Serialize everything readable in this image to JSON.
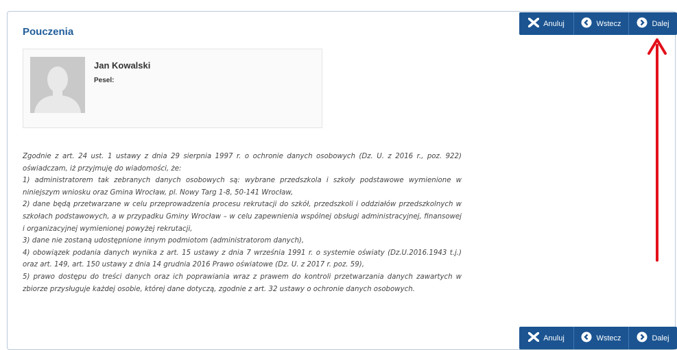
{
  "panel": {
    "title": "Pouczenia"
  },
  "person": {
    "name": "Jan Kowalski",
    "pesel_label": "Pesel:"
  },
  "notice": {
    "paragraphs": [
      "Zgodnie z art. 24 ust. 1 ustawy z dnia 29 sierpnia 1997 r. o ochronie danych osobowych (Dz. U. z 2016 r., poz. 922) oświadczam, iż przyjmuję do wiadomości, że:",
      "1) administratorem tak zebranych danych osobowych są: wybrane przedszkola i szkoły podstawowe wymienione w niniejszym wniosku oraz Gmina Wrocław, pl. Nowy Targ 1-8, 50-141 Wrocław,",
      "2) dane będą przetwarzane w celu przeprowadzenia procesu rekrutacji do szkół, przedszkoli i oddziałów przedszkolnych w szkołach podstawowych, a w przypadku Gminy Wrocław – w celu zapewnienia wspólnej obsługi administracyjnej, finansowej i organizacyjnej wymienionej powyżej rekrutacji,",
      "3) dane nie zostaną udostępnione innym podmiotom (administratorom danych),",
      "4) obowiązek podania danych wynika z art. 15 ustawy z dnia 7 września 1991 r. o systemie oświaty (Dz.U.2016.1943 t.j.) oraz art. 149, art. 150 ustawy z dnia 14 grudnia 2016 Prawo oświatowe (Dz. U. z 2017 r. poz. 59),",
      "5) prawo dostępu do treści danych oraz ich poprawiania wraz z prawem do kontroli przetwarzania danych zawartych w zbiorze przysługuje każdej osobie, której dane dotyczą, zgodnie z art. 32 ustawy o ochronie danych osobowych."
    ]
  },
  "buttons": {
    "cancel": "Anuluj",
    "back": "Wstecz",
    "next": "Dalej"
  },
  "colors": {
    "brand_blue": "#1b5491",
    "title_blue": "#215d9a",
    "annotation_red": "#e3101a"
  },
  "icons": {
    "cancel": "x-icon",
    "back": "circle-chevron-left-icon",
    "next": "circle-chevron-right-icon",
    "avatar": "person-silhouette-icon"
  }
}
